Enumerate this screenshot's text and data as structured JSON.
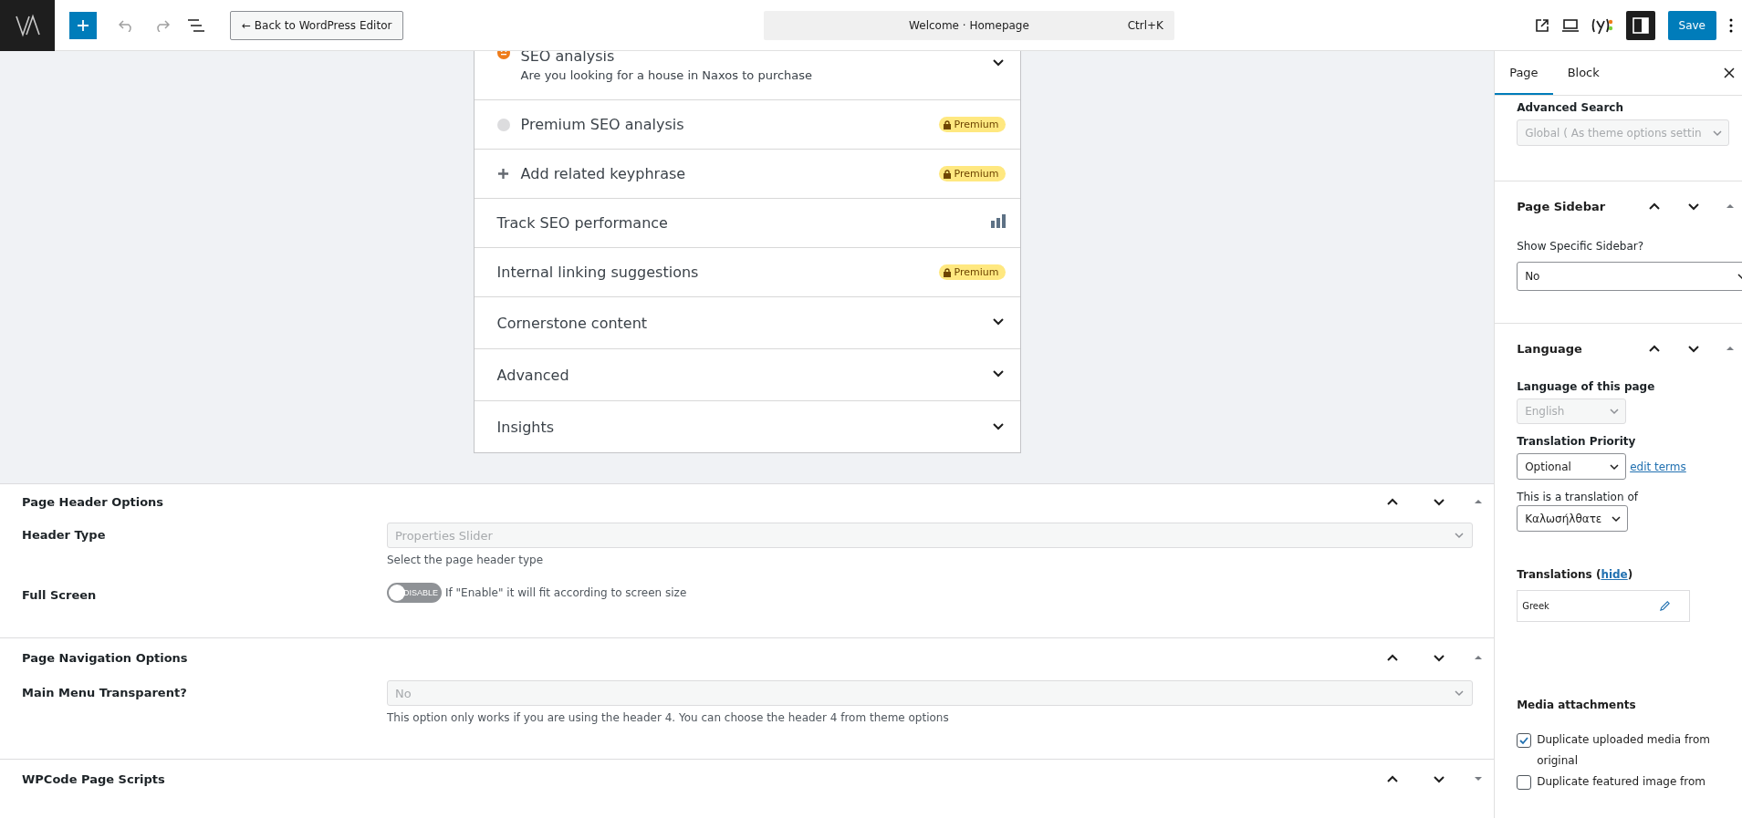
{
  "topbar": {
    "back_button": "← Back to WordPress Editor",
    "command": {
      "title": "Welcome · Homepage",
      "shortcut": "Ctrl+K"
    },
    "settings_open": true,
    "save": "Save"
  },
  "seo_panel": {
    "rows": [
      {
        "kind": "scored",
        "title": "SEO analysis",
        "subtitle": "Are you looking for a house in Naxos to purchase"
      },
      {
        "kind": "locked",
        "title": "Premium SEO analysis",
        "badge": "Premium"
      },
      {
        "kind": "addable",
        "title": "Add related keyphrase",
        "badge": "Premium"
      },
      {
        "kind": "tracked",
        "title": "Track SEO performance"
      },
      {
        "kind": "premium",
        "title": "Internal linking suggestions",
        "badge": "Premium"
      },
      {
        "kind": "collapsible",
        "title": "Cornerstone content"
      },
      {
        "kind": "collapsible",
        "title": "Advanced"
      },
      {
        "kind": "collapsible",
        "title": "Insights"
      }
    ]
  },
  "meta_boxes": [
    {
      "title": "Page Header Options",
      "expanded": true,
      "fields": [
        {
          "kind": "select",
          "label": "Header Type",
          "value": "Properties Slider",
          "disabled": true,
          "help": "Select the page header type"
        },
        {
          "kind": "toggle",
          "label": "Full Screen",
          "on": false,
          "toggle_text": "DISABLE",
          "help": "If \"Enable\" it will fit according to screen size"
        }
      ]
    },
    {
      "title": "Page Navigation Options",
      "expanded": true,
      "fields": [
        {
          "kind": "select",
          "label": "Main Menu Transparent?",
          "value": "No",
          "disabled": true,
          "help": "This option only works if you are using the header 4. You can choose the header 4 from theme options"
        }
      ]
    },
    {
      "title": "WPCode Page Scripts",
      "expanded": false
    }
  ],
  "sidebar": {
    "tabs": [
      {
        "label": "Page",
        "selected": true
      },
      {
        "label": "Block",
        "selected": false
      }
    ],
    "advanced_search": {
      "label": "Advanced Search",
      "value": "Global ( As theme options settin",
      "disabled": true
    },
    "page_sidebar": {
      "title": "Page Sidebar",
      "expanded": true,
      "label": "Show Specific Sidebar?",
      "value": "No"
    },
    "language": {
      "title": "Language",
      "expanded": true,
      "language_label": "Language of this page",
      "language_value": "English",
      "language_disabled": true,
      "priority_label": "Translation Priority",
      "priority_value": "Optional",
      "edit_terms": "edit terms",
      "translation_of_label": "This is a translation of",
      "translation_of_value": "Καλωσήλθατε",
      "translations_label": "Translations (",
      "hide_link": "hide",
      "translations_suffix": ")",
      "translations": [
        {
          "language": "Greek"
        }
      ],
      "media_title": "Media attachments",
      "checkboxes": [
        {
          "label": "Duplicate uploaded media from original",
          "checked": true
        },
        {
          "label": "Duplicate featured image from",
          "checked": false
        }
      ]
    }
  }
}
